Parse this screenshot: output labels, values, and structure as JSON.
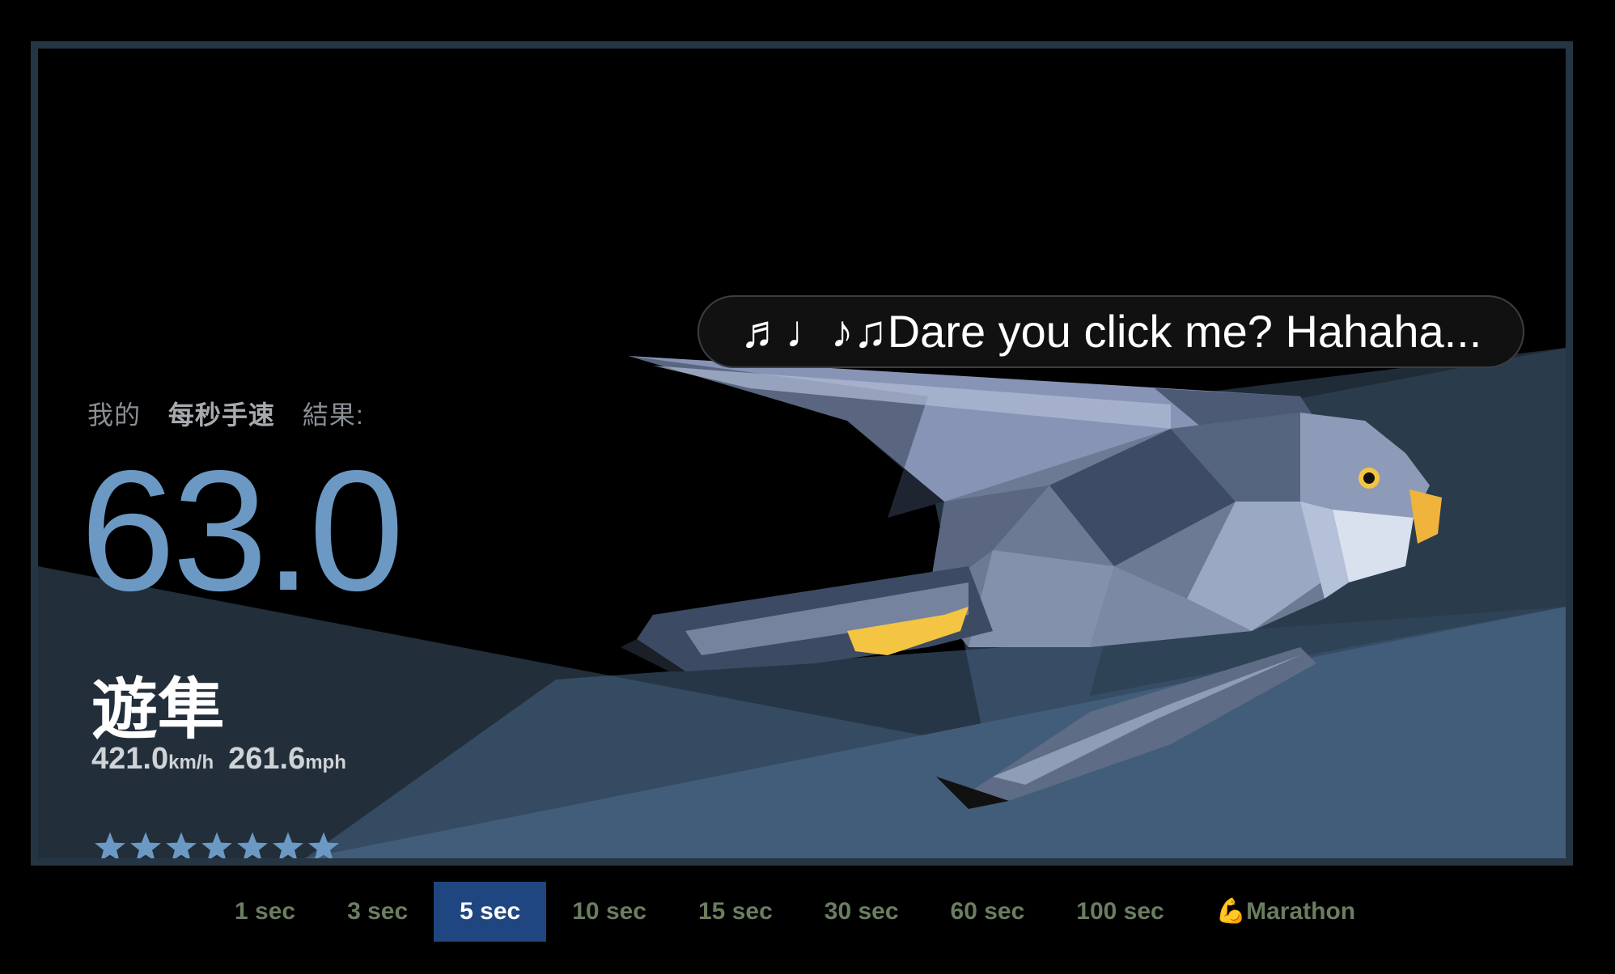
{
  "result": {
    "prefix": "我的",
    "metric": "每秒手速",
    "suffix": "結果:",
    "score": "63.0",
    "animal": "遊隼",
    "kmh": "421.0",
    "kmh_unit": "km/h",
    "mph": "261.6",
    "mph_unit": "mph",
    "stars": 7,
    "star_color": "#6c99c4",
    "score_color": "#6c99c4"
  },
  "bubble": {
    "text": "♬♩♪♫Dare you click me? Hahaha..."
  },
  "illustration": {
    "subject": "peregrine falcon (low-poly)",
    "icon": "falcon-illustration"
  },
  "tabs": [
    {
      "label": "1 sec",
      "active": false
    },
    {
      "label": "3 sec",
      "active": false
    },
    {
      "label": "5 sec",
      "active": true
    },
    {
      "label": "10 sec",
      "active": false
    },
    {
      "label": "15 sec",
      "active": false
    },
    {
      "label": "30 sec",
      "active": false
    },
    {
      "label": "60 sec",
      "active": false
    },
    {
      "label": "100 sec",
      "active": false
    },
    {
      "label": "💪Marathon",
      "active": false
    }
  ],
  "colors": {
    "frame": "#253544",
    "active_tab": "#1f4680",
    "inactive_tab_text": "#6b7d60"
  }
}
